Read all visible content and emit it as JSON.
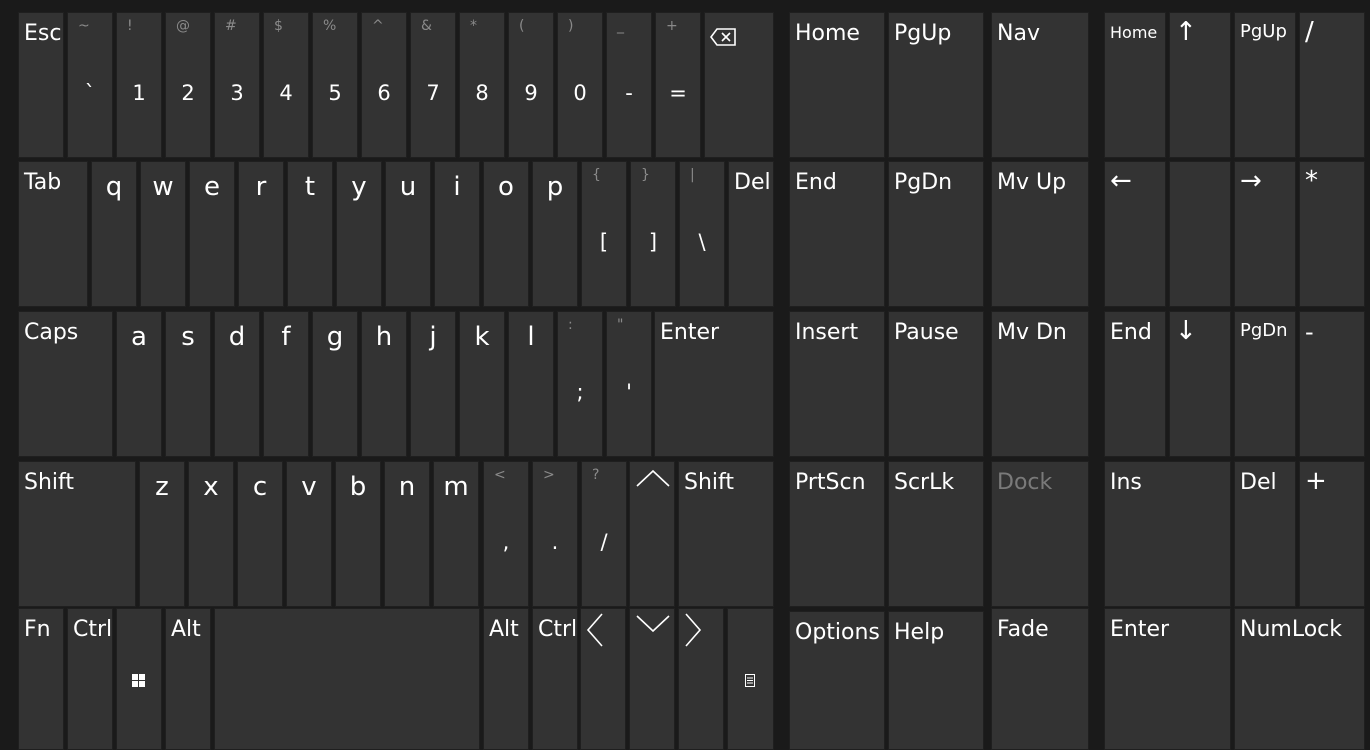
{
  "colors": {
    "background": "#1a1a1a",
    "key": "#333333",
    "text": "#ffffff",
    "dim_text": "#7a7a7a"
  },
  "row1": {
    "esc": "Esc",
    "num_keys": [
      {
        "shift": "~",
        "main": "`"
      },
      {
        "shift": "!",
        "main": "1"
      },
      {
        "shift": "@",
        "main": "2"
      },
      {
        "shift": "#",
        "main": "3"
      },
      {
        "shift": "$",
        "main": "4"
      },
      {
        "shift": "%",
        "main": "5"
      },
      {
        "shift": "^",
        "main": "6"
      },
      {
        "shift": "&",
        "main": "7"
      },
      {
        "shift": "*",
        "main": "8"
      },
      {
        "shift": "(",
        "main": "9"
      },
      {
        "shift": ")",
        "main": "0"
      },
      {
        "shift": "_",
        "main": "-"
      },
      {
        "shift": "+",
        "main": "="
      }
    ],
    "backspace_icon": "backspace-icon"
  },
  "row2": {
    "tab": "Tab",
    "letters": [
      "q",
      "w",
      "e",
      "r",
      "t",
      "y",
      "u",
      "i",
      "o",
      "p"
    ],
    "sym_keys": [
      {
        "shift": "{",
        "main": "["
      },
      {
        "shift": "}",
        "main": "]"
      },
      {
        "shift": "|",
        "main": "\\"
      }
    ],
    "del": "Del"
  },
  "row3": {
    "caps": "Caps",
    "letters": [
      "a",
      "s",
      "d",
      "f",
      "g",
      "h",
      "j",
      "k",
      "l"
    ],
    "sym_keys": [
      {
        "shift": ":",
        "main": ";"
      },
      {
        "shift": "\"",
        "main": "'"
      }
    ],
    "enter": "Enter"
  },
  "row4": {
    "shift_left": "Shift",
    "letters": [
      "z",
      "x",
      "c",
      "v",
      "b",
      "n",
      "m"
    ],
    "sym_keys": [
      {
        "shift": "<",
        "main": ","
      },
      {
        "shift": ">",
        "main": "."
      },
      {
        "shift": "?",
        "main": "/"
      }
    ],
    "shift_right": "Shift"
  },
  "row5": {
    "fn": "Fn",
    "ctrl_left": "Ctrl",
    "win_icon": "windows-logo-icon",
    "alt_left": "Alt",
    "alt_right": "Alt",
    "ctrl_right": "Ctrl",
    "menu_icon": "menu-icon"
  },
  "nav": {
    "home": "Home",
    "pgup": "PgUp",
    "nav": "Nav",
    "end": "End",
    "pgdn": "PgDn",
    "mvup": "Mv Up",
    "insert": "Insert",
    "pause": "Pause",
    "mvdn": "Mv Dn",
    "prtscn": "PrtScn",
    "scrlk": "ScrLk",
    "dock": "Dock",
    "options": "Options",
    "help": "Help",
    "fade": "Fade"
  },
  "numpad": {
    "home": "Home",
    "up": "↑",
    "pgup": "PgUp",
    "slash": "/",
    "left": "←",
    "right": "→",
    "star": "*",
    "end": "End",
    "down": "↓",
    "pgdn": "PgDn",
    "minus": "-",
    "ins": "Ins",
    "del": "Del",
    "plus": "+",
    "enter": "Enter",
    "numlock": "NumLock"
  }
}
